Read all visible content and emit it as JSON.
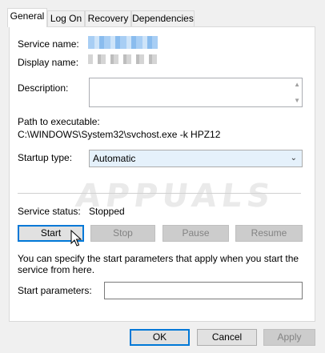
{
  "tabs": [
    {
      "label": "General",
      "active": true
    },
    {
      "label": "Log On"
    },
    {
      "label": "Recovery"
    },
    {
      "label": "Dependencies"
    }
  ],
  "general": {
    "service_name_label": "Service name:",
    "display_name_label": "Display name:",
    "description_label": "Description:",
    "path_label": "Path to executable:",
    "path_value": "C:\\WINDOWS\\System32\\svchost.exe -k HPZ12",
    "startup_type_label": "Startup type:",
    "startup_type_value": "Automatic",
    "service_status_label": "Service status:",
    "service_status_value": "Stopped",
    "buttons": {
      "start": "Start",
      "stop": "Stop",
      "pause": "Pause",
      "resume": "Resume"
    },
    "hint": "You can specify the start parameters that apply when you start the service from here.",
    "start_params_label": "Start parameters:",
    "start_params_value": ""
  },
  "footer": {
    "ok": "OK",
    "cancel": "Cancel",
    "apply": "Apply"
  },
  "watermark": "APPUALS"
}
